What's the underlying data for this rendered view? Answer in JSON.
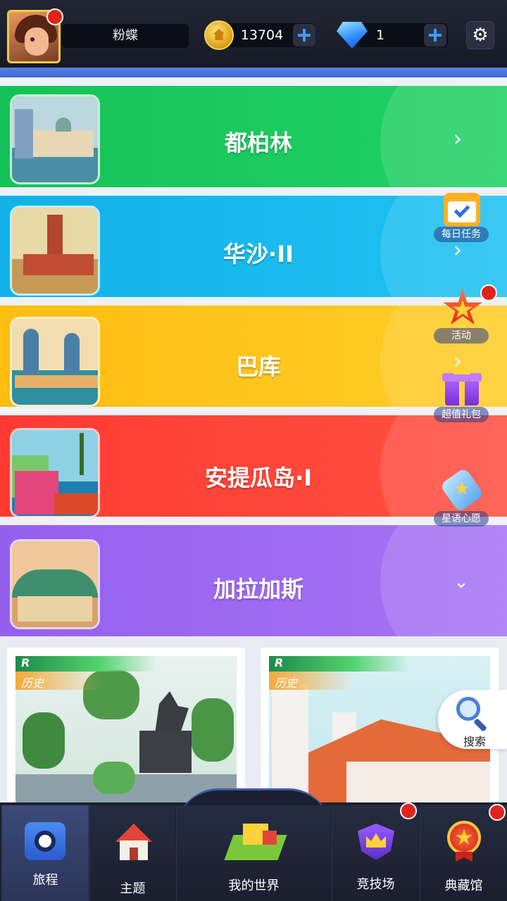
{
  "header": {
    "player_name": "粉蝶",
    "coins": "13704",
    "gems": "1",
    "has_avatar_alert": true
  },
  "cities": [
    {
      "name": "都柏林",
      "color": "#19c35a",
      "expanded": false
    },
    {
      "name": "华沙·II",
      "color": "#13b6ea",
      "expanded": false
    },
    {
      "name": "巴库",
      "color": "#ffc21a",
      "expanded": false
    },
    {
      "name": "安提瓜岛·I",
      "color": "#ff4436",
      "expanded": false
    },
    {
      "name": "加拉加斯",
      "color": "#9b67f0",
      "expanded": true
    }
  ],
  "cards": [
    {
      "rarity": "R",
      "tag": "历史"
    },
    {
      "rarity": "R",
      "tag": "历史"
    }
  ],
  "side_buttons": {
    "daily_tasks": "每日任务",
    "events": "活动",
    "value_pack": "超值礼包",
    "star_wish": "星语心愿",
    "search": "搜索"
  },
  "nav": {
    "journey": "旅程",
    "theme": "主题",
    "my_world": "我的世界",
    "arena": "竞技场",
    "collection": "典藏馆",
    "active_tab": "旅程"
  },
  "icons": {
    "settings": "gear-icon",
    "add_coins": "plus-icon",
    "add_gems": "plus-icon",
    "row_arrow": "chevron-right-icon",
    "expanded_arrow": "chevron-down-icon"
  }
}
